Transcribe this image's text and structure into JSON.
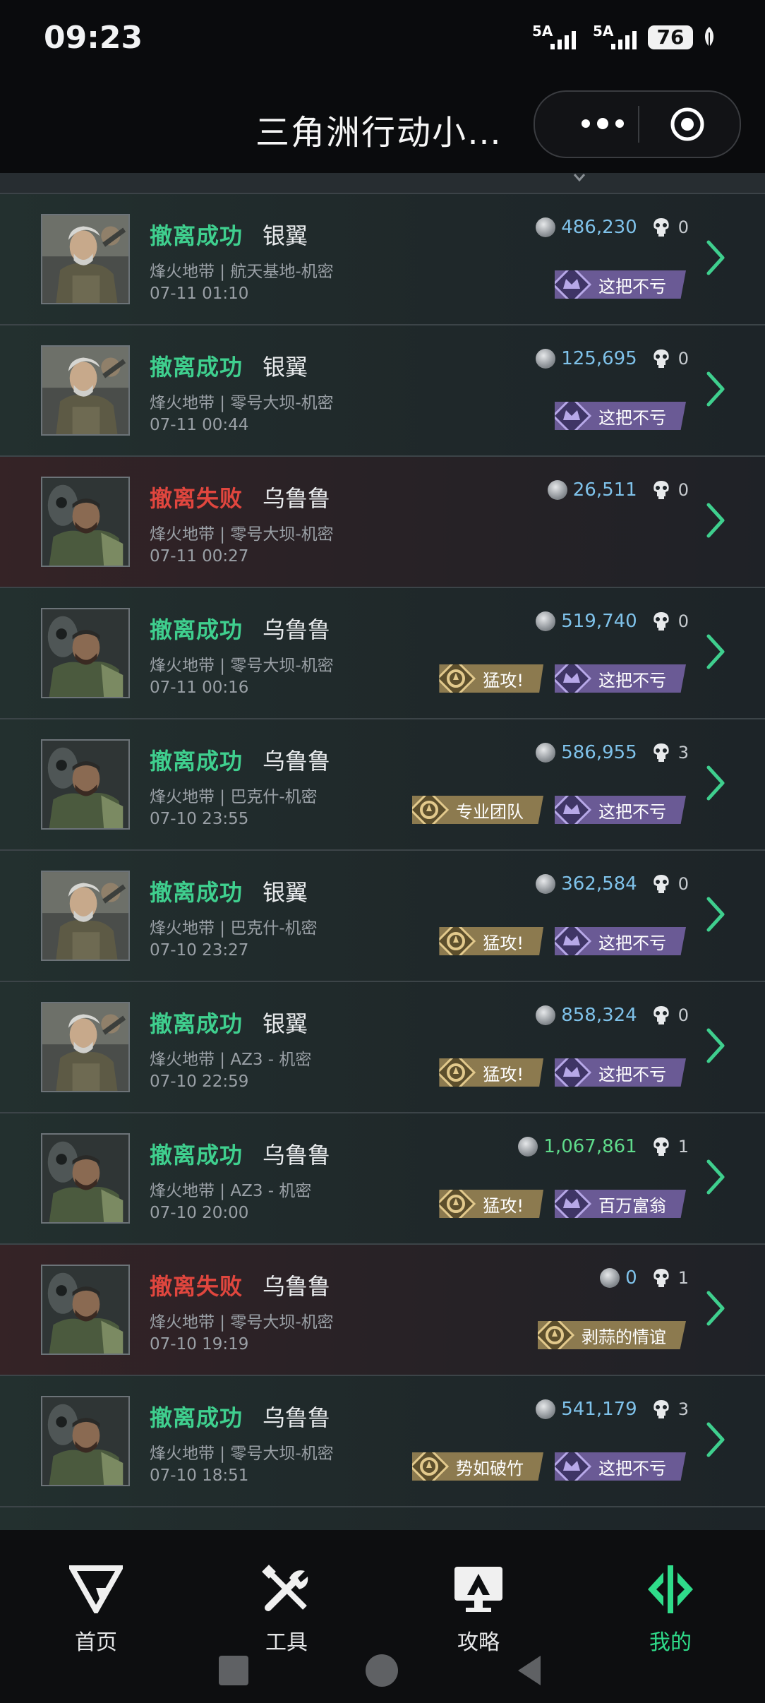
{
  "status_bar": {
    "time": "09:23",
    "signal1": "5A",
    "signal2": "5A",
    "battery": "76"
  },
  "header": {
    "title": "三角洲行动小…"
  },
  "records": [
    {
      "result": "撤离成功",
      "ok": true,
      "operator": "银翼",
      "map": "烽火地带 | 航天基地-机密",
      "date": "07-11 01:10",
      "value": "486,230",
      "kills": "0",
      "badges": [
        {
          "label": "这把不亏",
          "style": "purple"
        }
      ]
    },
    {
      "result": "撤离成功",
      "ok": true,
      "operator": "银翼",
      "map": "烽火地带 | 零号大坝-机密",
      "date": "07-11 00:44",
      "value": "125,695",
      "kills": "0",
      "badges": [
        {
          "label": "这把不亏",
          "style": "purple"
        }
      ]
    },
    {
      "result": "撤离失败",
      "ok": false,
      "operator": "乌鲁鲁",
      "map": "烽火地带 | 零号大坝-机密",
      "date": "07-11 00:27",
      "value": "26,511",
      "kills": "0",
      "badges": []
    },
    {
      "result": "撤离成功",
      "ok": true,
      "operator": "乌鲁鲁",
      "map": "烽火地带 | 零号大坝-机密",
      "date": "07-11 00:16",
      "value": "519,740",
      "kills": "0",
      "badges": [
        {
          "label": "猛攻!",
          "style": "gold"
        },
        {
          "label": "这把不亏",
          "style": "purple"
        }
      ]
    },
    {
      "result": "撤离成功",
      "ok": true,
      "operator": "乌鲁鲁",
      "map": "烽火地带 | 巴克什-机密",
      "date": "07-10 23:55",
      "value": "586,955",
      "kills": "3",
      "badges": [
        {
          "label": "专业团队",
          "style": "gold"
        },
        {
          "label": "这把不亏",
          "style": "purple"
        }
      ]
    },
    {
      "result": "撤离成功",
      "ok": true,
      "operator": "银翼",
      "map": "烽火地带 | 巴克什-机密",
      "date": "07-10 23:27",
      "value": "362,584",
      "kills": "0",
      "badges": [
        {
          "label": "猛攻!",
          "style": "gold"
        },
        {
          "label": "这把不亏",
          "style": "purple"
        }
      ]
    },
    {
      "result": "撤离成功",
      "ok": true,
      "operator": "银翼",
      "map": "烽火地带 | AZ3 - 机密",
      "date": "07-10 22:59",
      "value": "858,324",
      "kills": "0",
      "badges": [
        {
          "label": "猛攻!",
          "style": "gold"
        },
        {
          "label": "这把不亏",
          "style": "purple"
        }
      ]
    },
    {
      "result": "撤离成功",
      "ok": true,
      "operator": "乌鲁鲁",
      "map": "烽火地带 | AZ3 - 机密",
      "date": "07-10 20:00",
      "value": "1,067,861",
      "kills": "1",
      "big": true,
      "badges": [
        {
          "label": "猛攻!",
          "style": "gold"
        },
        {
          "label": "百万富翁",
          "style": "purple"
        }
      ]
    },
    {
      "result": "撤离失败",
      "ok": false,
      "operator": "乌鲁鲁",
      "map": "烽火地带 | 零号大坝-机密",
      "date": "07-10 19:19",
      "value": "0",
      "kills": "1",
      "badges": [
        {
          "label": "剥蒜的情谊",
          "style": "gold"
        }
      ]
    },
    {
      "result": "撤离成功",
      "ok": true,
      "operator": "乌鲁鲁",
      "map": "烽火地带 | 零号大坝-机密",
      "date": "07-10 18:51",
      "value": "541,179",
      "kills": "3",
      "badges": [
        {
          "label": "势如破竹",
          "style": "gold"
        },
        {
          "label": "这把不亏",
          "style": "purple"
        }
      ]
    }
  ],
  "nav": [
    {
      "label": "首页",
      "icon": "delta-logo-icon"
    },
    {
      "label": "工具",
      "icon": "tools-icon"
    },
    {
      "label": "攻略",
      "icon": "guide-monitor-icon"
    },
    {
      "label": "我的",
      "icon": "profile-icon",
      "active": true
    }
  ],
  "colors": {
    "success": "#3fcf8e",
    "fail": "#e0463e",
    "accent": "#2fdc8a",
    "value": "#7fc2ea"
  }
}
